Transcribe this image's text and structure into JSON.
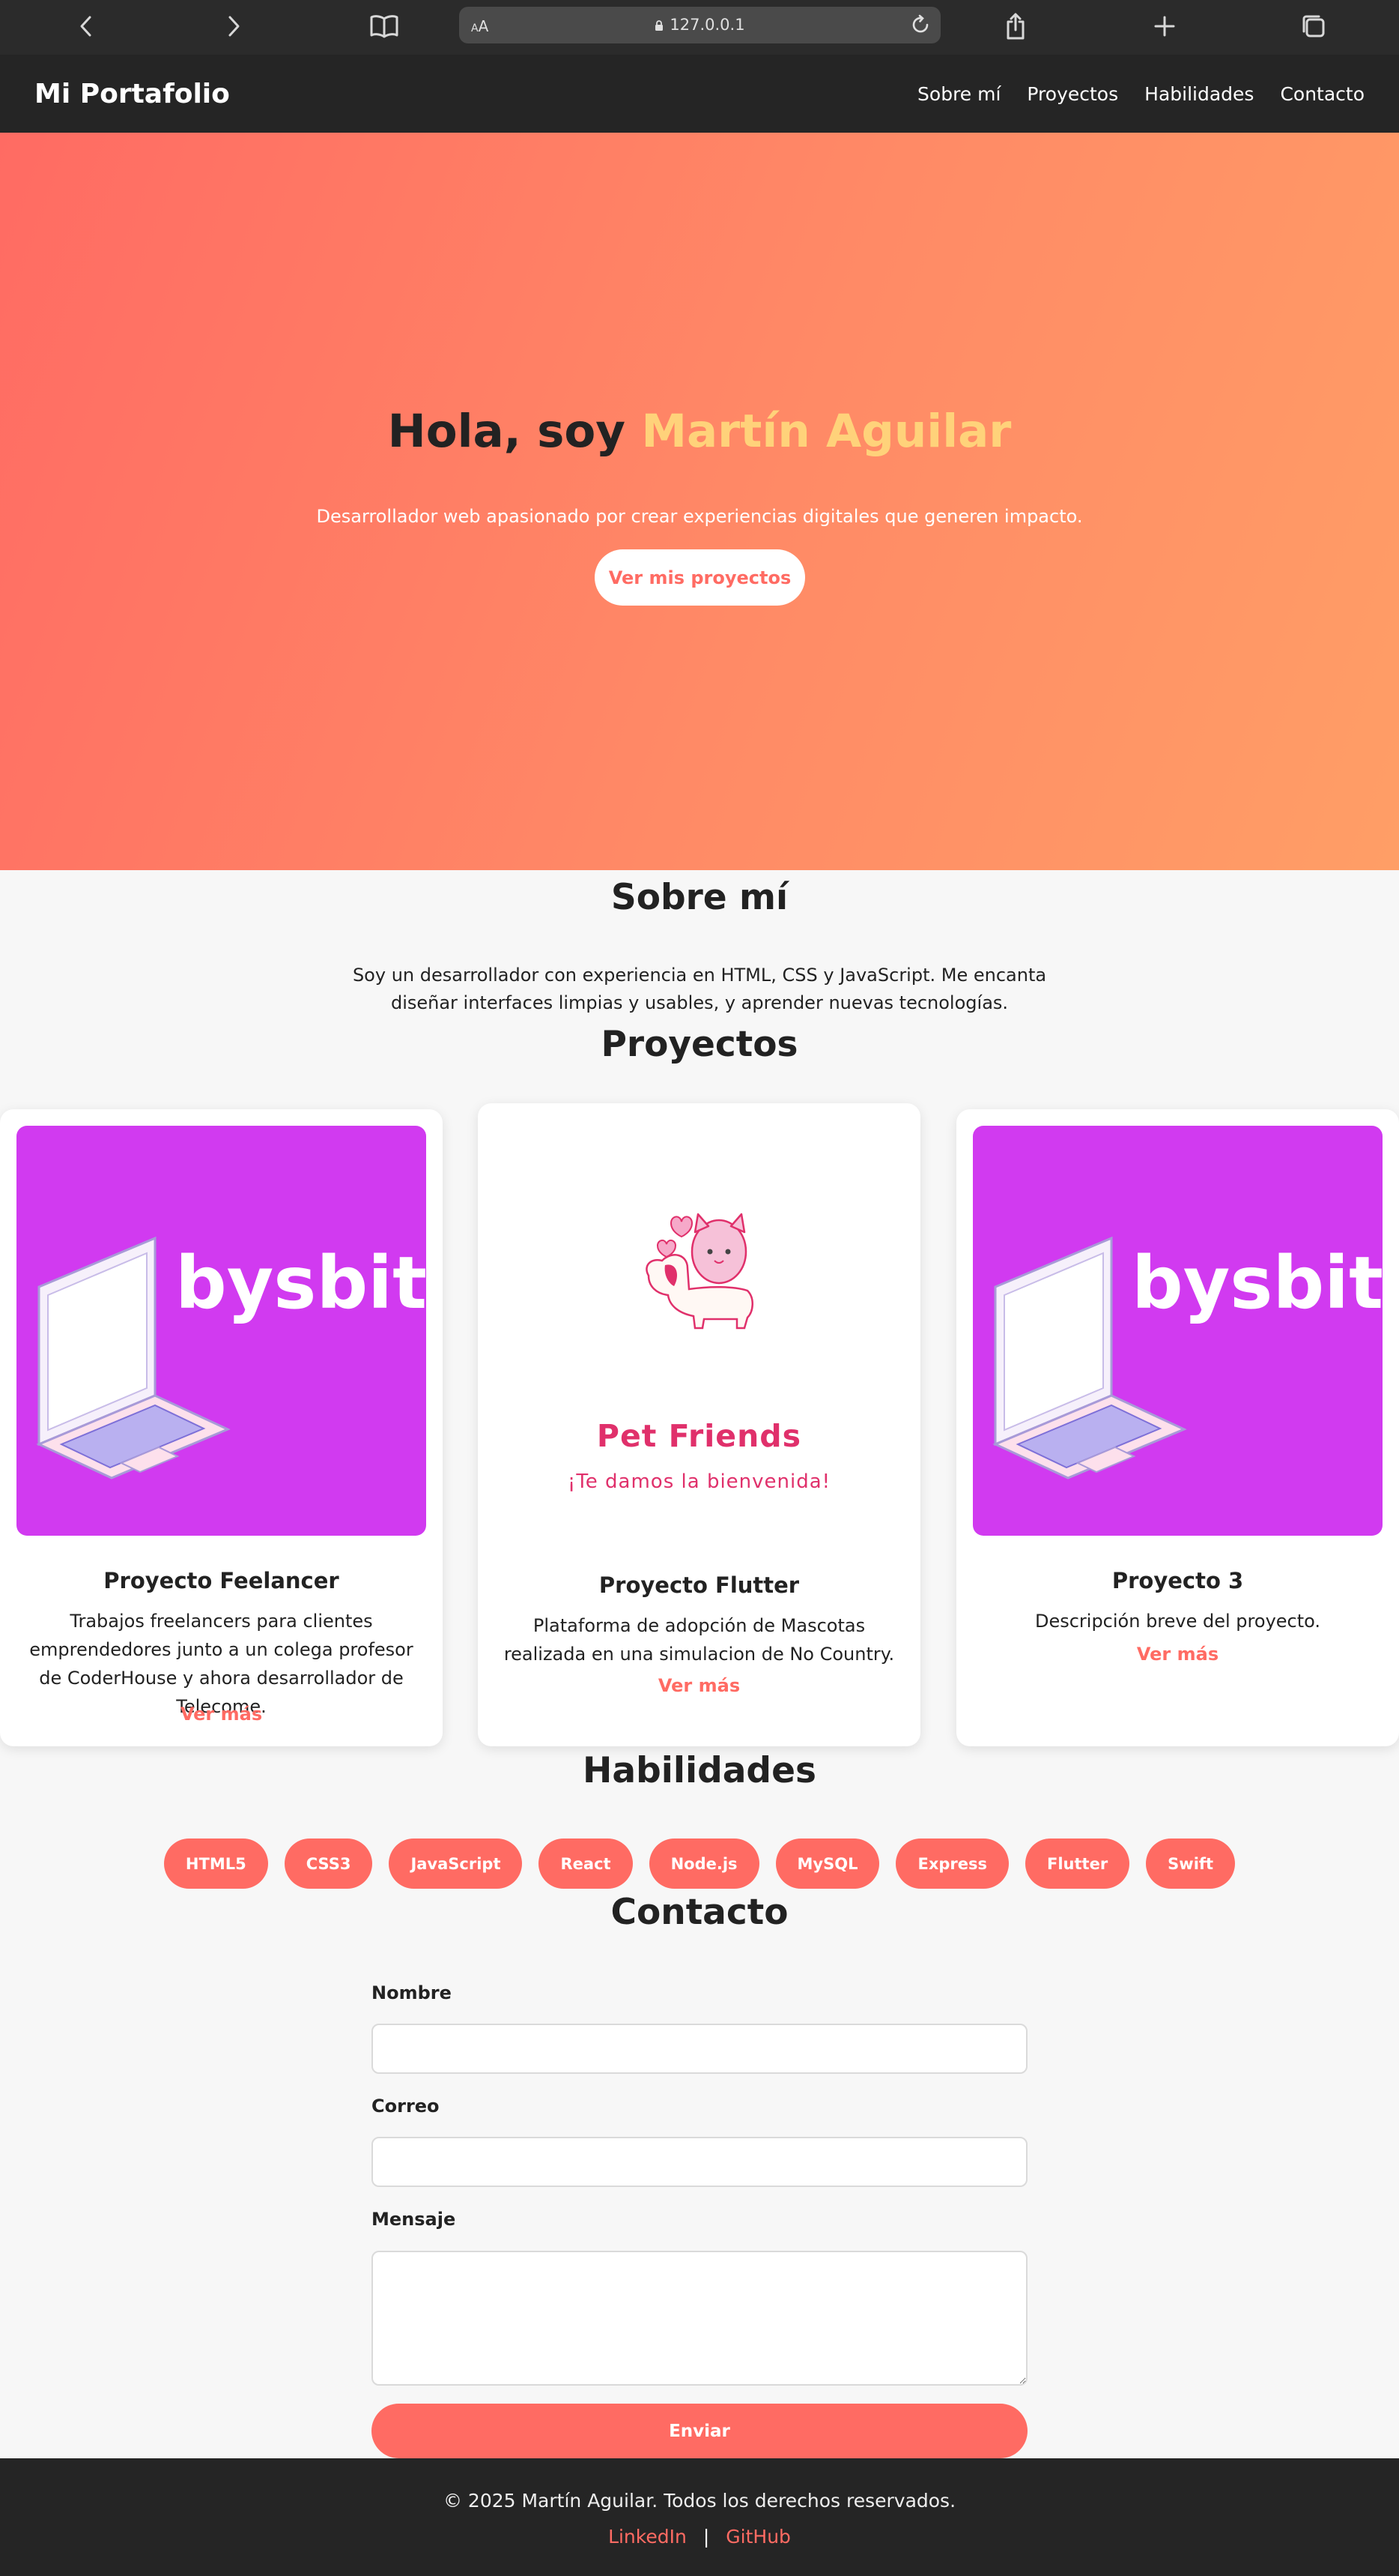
{
  "browser": {
    "url": "127.0.0.1",
    "reader_label": "AA"
  },
  "nav": {
    "brand": "Mi Portafolio",
    "links": [
      "Sobre mí",
      "Proyectos",
      "Habilidades",
      "Contacto"
    ]
  },
  "hero": {
    "greeting": "Hola, soy ",
    "name": "Martín Aguilar",
    "subtitle": "Desarrollador web apasionado por crear experiencias digitales que generen impacto.",
    "cta": "Ver mis proyectos"
  },
  "about": {
    "title": "Sobre mí",
    "text": "Soy un desarrollador con experiencia en HTML, CSS y JavaScript. Me encanta diseñar interfaces limpias y usables, y aprender nuevas tecnologías."
  },
  "projects": {
    "title": "Proyectos",
    "items": [
      {
        "image_text": "bysbit",
        "title": "Proyecto Feelancer",
        "description": "Trabajos freelancers para clientes emprendedores junto a un colega profesor de CoderHouse y ahora desarrollador de Telecome.",
        "link": "Ver más"
      },
      {
        "image_title": "Pet Friends",
        "image_subtitle": "¡Te damos la bienvenida!",
        "title": "Proyecto Flutter",
        "description": "Plataforma de adopción de Mascotas realizada en una simulacion de No Country.",
        "link": "Ver más"
      },
      {
        "image_text": "bysbit",
        "title": "Proyecto 3",
        "description": "Descripción breve del proyecto.",
        "link": "Ver más"
      }
    ]
  },
  "skills": {
    "title": "Habilidades",
    "items": [
      "HTML5",
      "CSS3",
      "JavaScript",
      "React",
      "Node.js",
      "MySQL",
      "Express",
      "Flutter",
      "Swift"
    ]
  },
  "contact": {
    "title": "Contacto",
    "name_label": "Nombre",
    "name_value": "",
    "email_label": "Correo",
    "email_value": "",
    "message_label": "Mensaje",
    "message_value": "",
    "submit": "Enviar"
  },
  "footer": {
    "copyright": "© 2025 Martín Aguilar. Todos los derechos reservados.",
    "links": [
      "LinkedIn",
      "GitHub"
    ],
    "separator": "|"
  },
  "colors": {
    "accent": "#ff6b63",
    "highlight": "#ffd27a",
    "dark": "#252525",
    "project_bg": "#d13af0",
    "pet_pink": "#e0306b"
  }
}
